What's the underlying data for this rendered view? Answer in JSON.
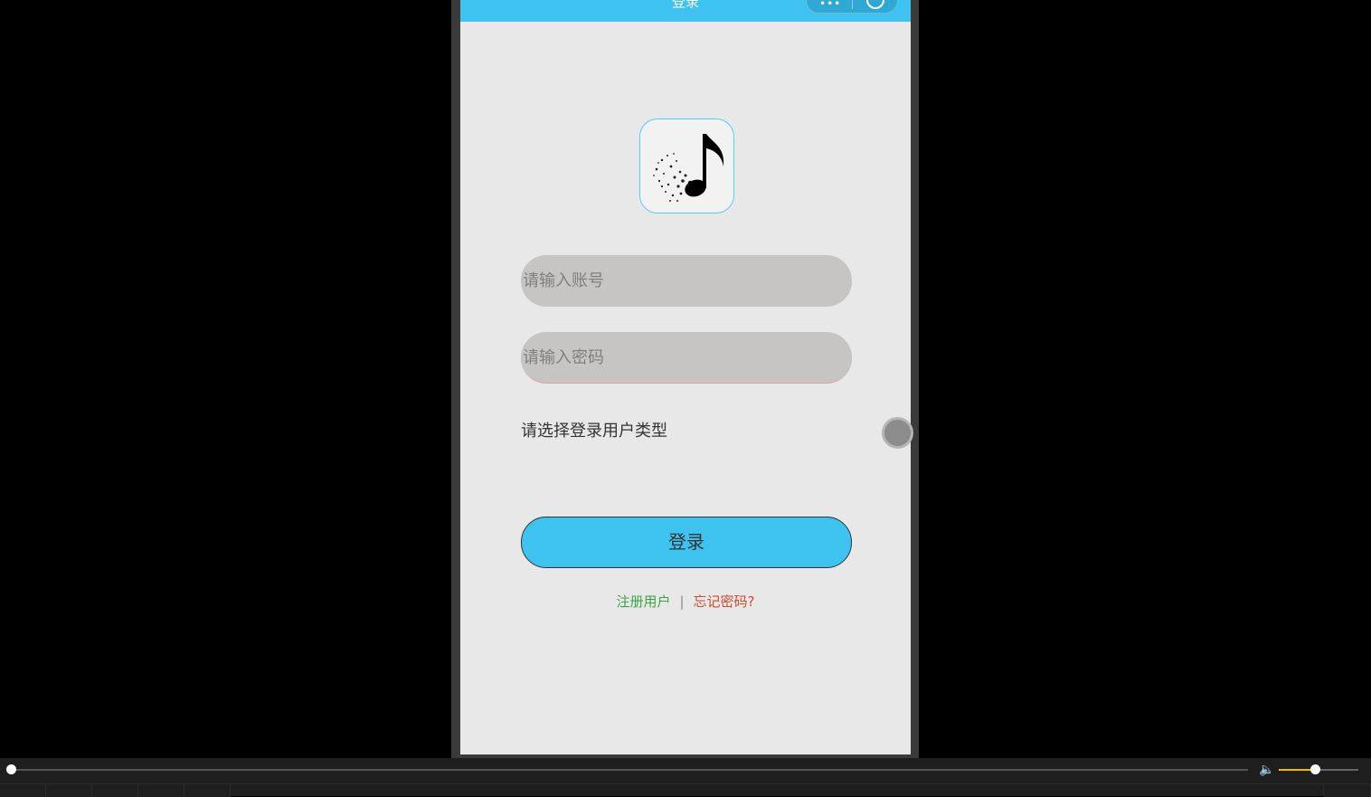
{
  "nav": {
    "title": "登录",
    "menu_icon": "more-dots-icon",
    "close_icon": "close-circle-icon",
    "color": "#3ec3f1"
  },
  "logo": {
    "icon": "music-note-icon"
  },
  "form": {
    "account_placeholder": "请输入账号",
    "password_placeholder": "请输入密码",
    "user_type_label": "请选择登录用户类型",
    "login_label": "登录"
  },
  "links": {
    "register": "注册用户",
    "divider": "|",
    "forgot": "忘记密码?",
    "register_color": "#3aa742",
    "forgot_color": "#d14a2c"
  },
  "player": {
    "progress": 0,
    "volume": 0.45,
    "volume_color": "#f0c000",
    "volume_icon": "speaker-icon"
  }
}
